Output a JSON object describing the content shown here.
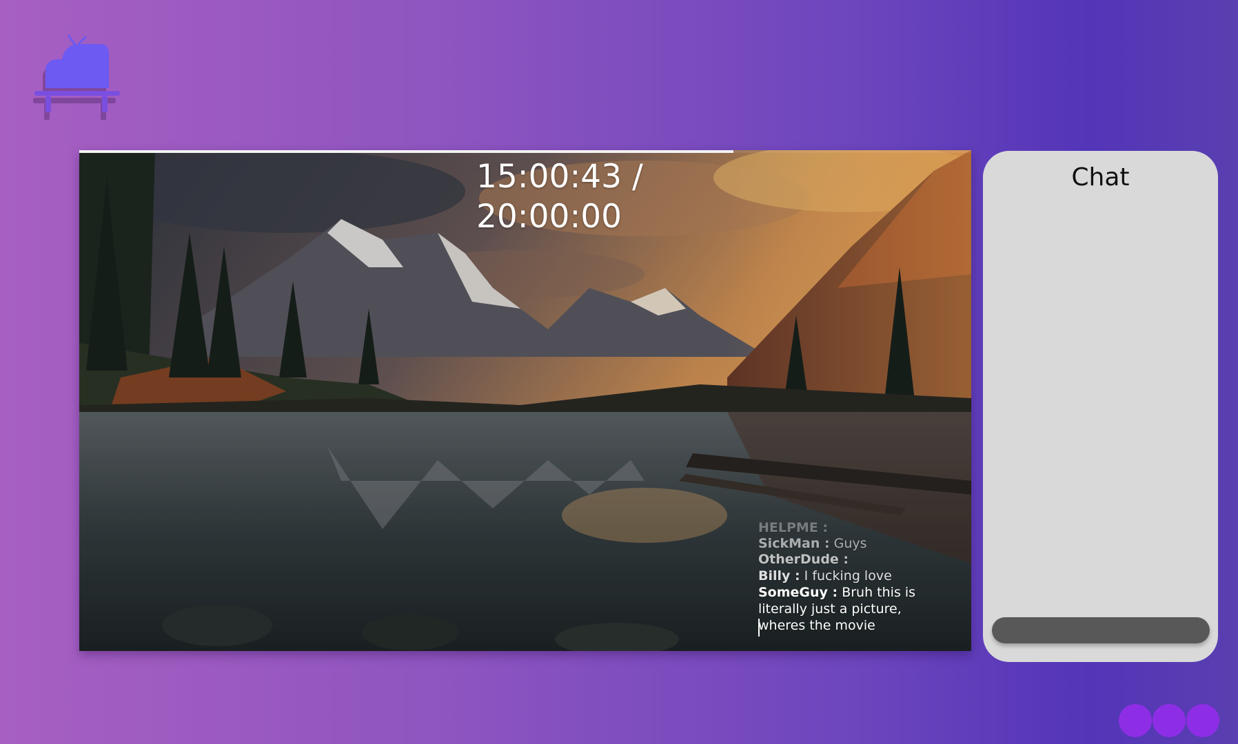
{
  "app": {
    "logo_icon": "piano-tv-icon",
    "accent_color": "#8e2de6",
    "logo_color": "#6c5af2"
  },
  "player": {
    "progress_fraction": 0.733,
    "time": {
      "current": "15:00:43 /",
      "total": "20:00:00"
    },
    "overlay_chat": [
      {
        "user": "HELPME :",
        "text": ""
      },
      {
        "user": "SickMan :",
        "text": "Guys"
      },
      {
        "user": "OtherDude :",
        "text": ""
      },
      {
        "user": "Billy :",
        "text": "I fucking love"
      },
      {
        "user": "SomeGuy :",
        "text": "Bruh this is literally just a picture, wheres the movie"
      }
    ]
  },
  "chat": {
    "title": "Chat",
    "input_value": ""
  },
  "dots": {
    "count": 3,
    "color": "#8e2de6"
  }
}
